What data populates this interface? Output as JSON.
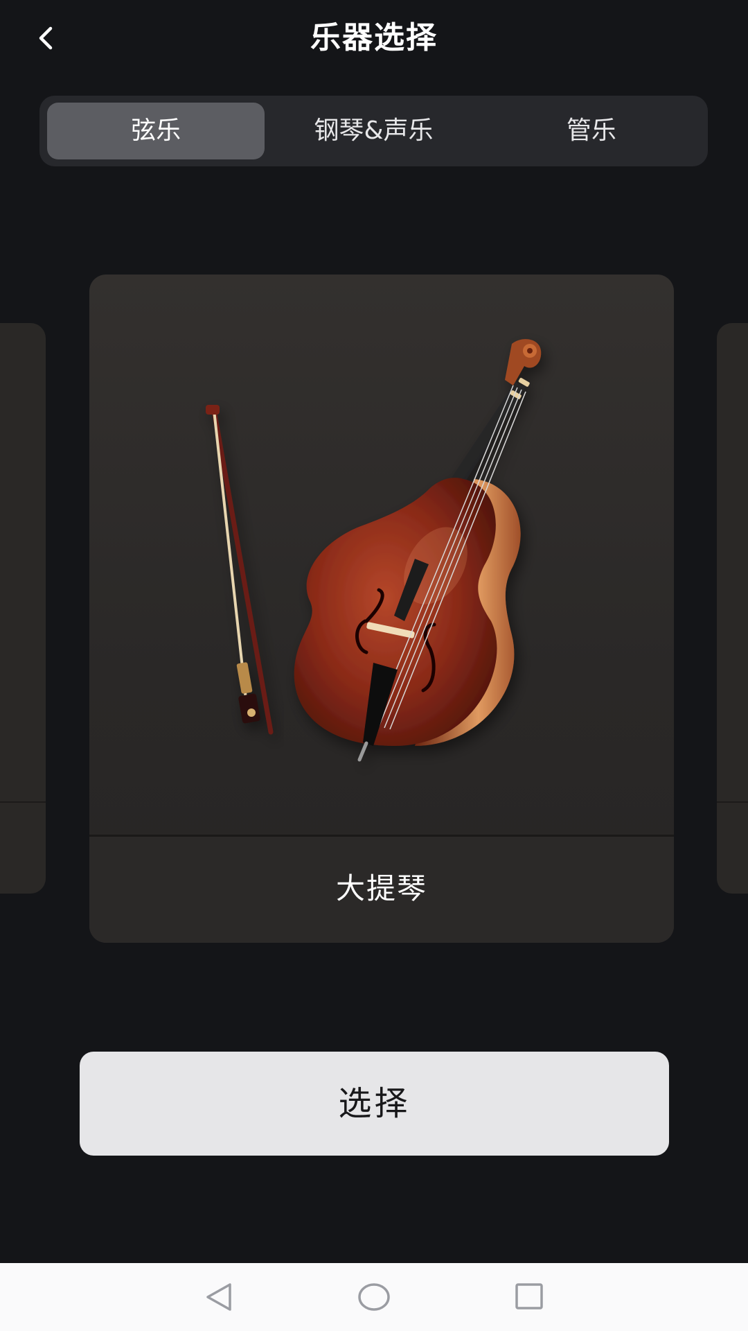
{
  "header": {
    "title": "乐器选择",
    "back_icon": "chevron-left-icon"
  },
  "tabs": [
    {
      "label": "弦乐",
      "active": true
    },
    {
      "label": "钢琴&声乐",
      "active": false
    },
    {
      "label": "管乐",
      "active": false
    }
  ],
  "carousel": {
    "current": {
      "name": "大提琴",
      "icon": "double-bass-with-bow-illustration"
    }
  },
  "actions": {
    "select_label": "选择"
  },
  "system_nav": {
    "back_icon": "triangle-back-icon",
    "home_icon": "circle-home-icon",
    "recents_icon": "square-recents-icon"
  },
  "colors": {
    "background": "#141518",
    "tab_bar": "#27282c",
    "tab_active": "#5c5d62",
    "card": "#2b2928",
    "button": "#e6e6e8",
    "nav_bar": "#fafafb"
  }
}
